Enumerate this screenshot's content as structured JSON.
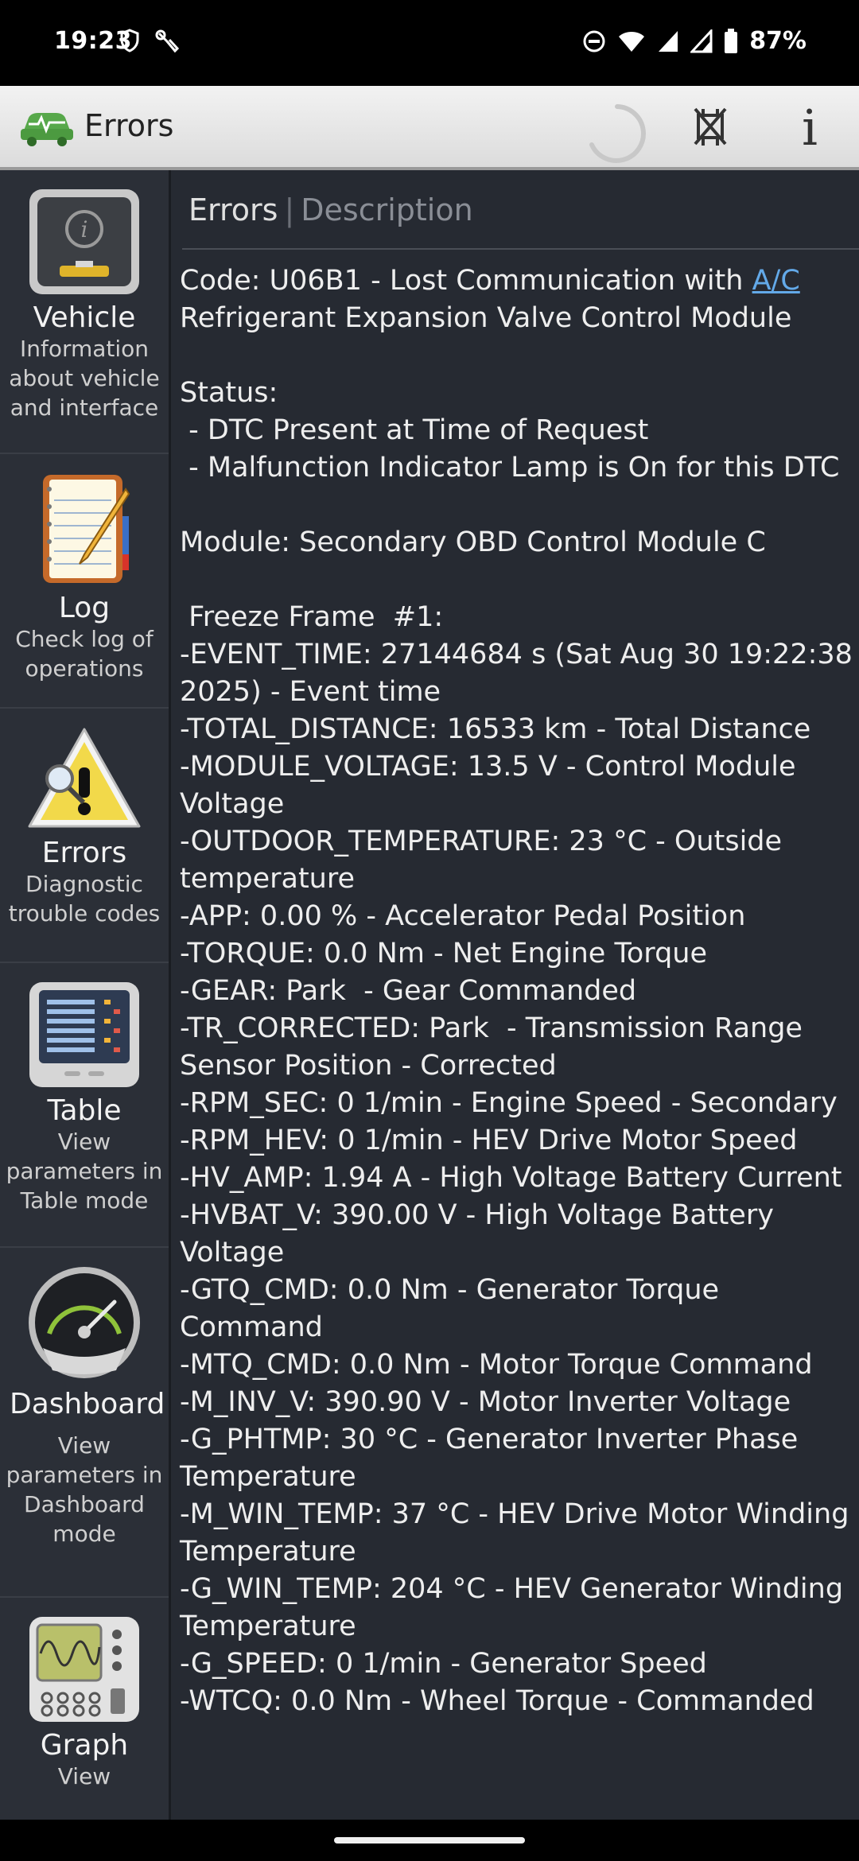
{
  "status_bar": {
    "time": "19:23",
    "battery": "87%",
    "icons": [
      "shield-icon",
      "wrench-icon",
      "dnd-icon",
      "wifi-icon",
      "signal-icon",
      "signal-icon",
      "battery-icon"
    ]
  },
  "app_bar": {
    "title": "Errors",
    "info_label": "i",
    "icons": [
      "car-obd-icon",
      "loading-spinner",
      "clear-errors-icon",
      "info-icon"
    ]
  },
  "sidebar": {
    "items": [
      {
        "title": "Vehicle",
        "desc": "Information about vehicle and interface",
        "icon": "vehicle-info-icon"
      },
      {
        "title": "Log",
        "desc": "Check log of operations",
        "icon": "notepad-icon"
      },
      {
        "title": "Errors",
        "desc": "Diagnostic trouble codes",
        "icon": "warning-icon"
      },
      {
        "title": "Table",
        "desc": "View parameters in Table mode",
        "icon": "table-icon"
      },
      {
        "title": "Dashboard",
        "desc": "View parameters in Dashboard mode",
        "icon": "gauge-icon"
      },
      {
        "title": "Graph",
        "desc": "View",
        "icon": "oscilloscope-icon"
      }
    ]
  },
  "content": {
    "tabs": {
      "errors": "Errors",
      "separator": "|",
      "description": "Description"
    },
    "code_prefix": "Code: U06B1 - Lost Communication with ",
    "code_link": "A/C",
    "code_suffix": "Refrigerant Expansion Valve Control Module",
    "status_header": "Status:",
    "status_lines": [
      " - DTC Present at Time of Request",
      " - Malfunction Indicator Lamp is On for this DTC"
    ],
    "module": "Module: Secondary OBD Control Module C",
    "freeze_header": " Freeze Frame  #1:",
    "freeze_lines": [
      "-EVENT_TIME: 27144684 s (Sat Aug 30 19:22:38 2025) - Event time",
      "-TOTAL_DISTANCE: 16533 km - Total Distance",
      "-MODULE_VOLTAGE: 13.5 V - Control Module Voltage",
      "-OUTDOOR_TEMPERATURE: 23 °C - Outside temperature",
      "-APP: 0.00 % - Accelerator Pedal Position",
      "-TORQUE: 0.0 Nm - Net Engine Torque",
      "-GEAR: Park  - Gear Commanded",
      "-TR_CORRECTED: Park  - Transmission Range Sensor Position - Corrected",
      "-RPM_SEC: 0 1/min - Engine Speed - Secondary",
      "-RPM_HEV: 0 1/min - HEV Drive Motor Speed",
      "-HV_AMP: 1.94 A - High Voltage Battery Current",
      "-HVBAT_V: 390.00 V - High Voltage Battery Voltage",
      "-GTQ_CMD: 0.0 Nm - Generator Torque Command",
      "-MTQ_CMD: 0.0 Nm - Motor Torque Command",
      "-M_INV_V: 390.90 V - Motor Inverter Voltage",
      "-G_PHTMP: 30 °C - Generator Inverter Phase Temperature",
      "-M_WIN_TEMP: 37 °C - HEV Drive Motor Winding Temperature",
      "-G_WIN_TEMP: 204 °C - HEV Generator Winding Temperature",
      "-G_SPEED: 0 1/min - Generator Speed",
      "-WTCQ: 0.0 Nm - Wheel Torque - Commanded"
    ]
  }
}
